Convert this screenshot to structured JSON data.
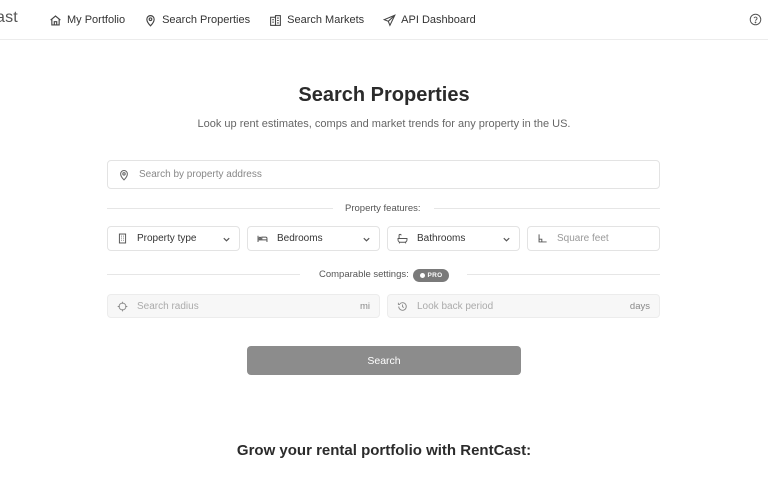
{
  "nav": {
    "logo": "ast",
    "items": [
      {
        "label": "My Portfolio",
        "icon": "home-icon"
      },
      {
        "label": "Search Properties",
        "icon": "map-pin-icon"
      },
      {
        "label": "Search Markets",
        "icon": "buildings-icon"
      },
      {
        "label": "API Dashboard",
        "icon": "send-icon"
      }
    ],
    "help_icon": "help-circle-icon"
  },
  "hero": {
    "title": "Search Properties",
    "subtitle": "Look up rent estimates, comps and market trends for any property in the US."
  },
  "search": {
    "address_placeholder": "Search by property address"
  },
  "features": {
    "label": "Property features:",
    "property_type": "Property type",
    "bedrooms": "Bedrooms",
    "bathrooms": "Bathrooms",
    "square_feet_placeholder": "Square feet"
  },
  "comparable": {
    "label": "Comparable settings:",
    "badge": "PRO",
    "radius_placeholder": "Search radius",
    "radius_unit": "mi",
    "lookback_placeholder": "Look back period",
    "lookback_unit": "days"
  },
  "search_button": "Search",
  "promo_heading": "Grow your rental portfolio with RentCast:",
  "colors": {
    "button": "#8c8c8c",
    "badge": "#7a7a7a",
    "text": "#333333"
  }
}
